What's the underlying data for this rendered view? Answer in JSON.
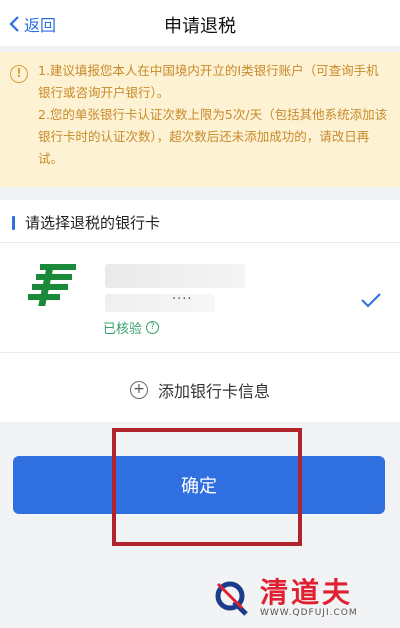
{
  "nav": {
    "back_label": "返回",
    "title": "申请退税"
  },
  "notice": {
    "icon": "exclamation-icon",
    "lines": [
      "1.建议填报您本人在中国境内开立的Ⅰ类银行账户（可查询手机银行或咨询开户银行）。",
      "2.您的单张银行卡认证次数上限为5次/天（包括其他系统添加该银行卡时的认证次数），超次数后还未添加成功的，请改日再试。"
    ]
  },
  "bank_section": {
    "title": "请选择退税的银行卡",
    "card_number_masked": "····",
    "verified_label": "已核验",
    "help_icon": "question-icon",
    "selected_icon": "check-icon"
  },
  "add_bank_label": "添加银行卡信息",
  "confirm_label": "确定",
  "watermark": {
    "brand": "清道夫",
    "url": "WWW.QDFUJI.COM"
  },
  "colors": {
    "accent": "#2f6fe0",
    "notice_bg": "#fdf2d3",
    "notice_text": "#c88a2a",
    "verified": "#35a06a",
    "annotation_box": "#b2242b"
  }
}
